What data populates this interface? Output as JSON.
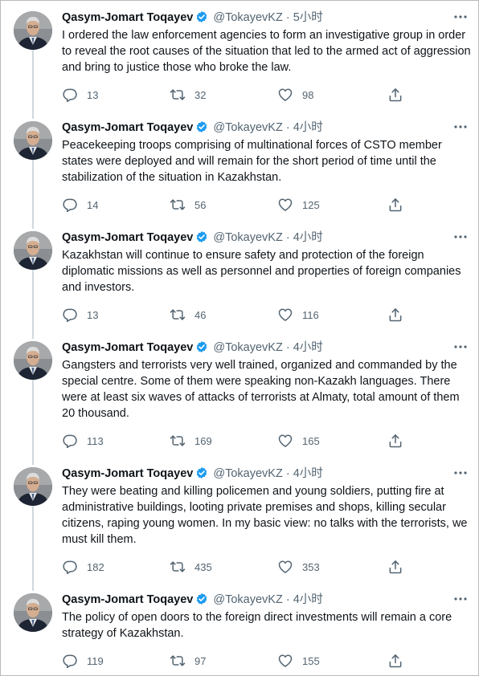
{
  "tweets": [
    {
      "name": "Qasym-Jomart Toqayev",
      "handle": "@TokayevKZ",
      "sep": "·",
      "time": "5小时",
      "text": "I ordered the law enforcement agencies to form an investigative group in order to reveal the root causes of the situation that led to the armed act of aggression and bring to justice those who broke the law.",
      "replies": "13",
      "retweets": "32",
      "likes": "98"
    },
    {
      "name": "Qasym-Jomart Toqayev",
      "handle": "@TokayevKZ",
      "sep": "·",
      "time": "4小时",
      "text": "Peacekeeping troops comprising of multinational forces of CSTO member states were deployed and will remain for the short period of time until the stabilization of the situation in Kazakhstan.",
      "replies": "14",
      "retweets": "56",
      "likes": "125"
    },
    {
      "name": "Qasym-Jomart Toqayev",
      "handle": "@TokayevKZ",
      "sep": "·",
      "time": "4小时",
      "text": "Kazakhstan will continue to ensure safety and protection of the foreign diplomatic missions as well as personnel and properties of foreign companies and investors.",
      "replies": "13",
      "retweets": "46",
      "likes": "116"
    },
    {
      "name": "Qasym-Jomart Toqayev",
      "handle": "@TokayevKZ",
      "sep": "·",
      "time": "4小时",
      "text": "Gangsters and terrorists very well trained, organized and commanded by the special centre. Some of them were speaking non-Kazakh languages. There were at least six waves of attacks of terrorists at Almaty, total amount of them 20 thousand.",
      "replies": "113",
      "retweets": "169",
      "likes": "165"
    },
    {
      "name": "Qasym-Jomart Toqayev",
      "handle": "@TokayevKZ",
      "sep": "·",
      "time": "4小时",
      "text": "They were beating and killing policemen and young soldiers, putting fire at administrative buildings, looting private premises and shops, killing secular citizens, raping young women. In my basic view: no talks with the terrorists, we must kill them.",
      "replies": "182",
      "retweets": "435",
      "likes": "353"
    },
    {
      "name": "Qasym-Jomart Toqayev",
      "handle": "@TokayevKZ",
      "sep": "·",
      "time": "4小时",
      "text": "The policy of open doors to the foreign direct investments will remain a core strategy of Kazakhstan.",
      "replies": "119",
      "retweets": "97",
      "likes": "155"
    }
  ],
  "icons": {
    "verified": "verified-badge-icon",
    "more": "more-options-icon",
    "reply": "reply-icon",
    "retweet": "retweet-icon",
    "like": "like-icon",
    "share": "share-icon"
  },
  "colors": {
    "verified": "#1d9bf0",
    "muted": "#536471",
    "text": "#0f1419",
    "thread": "#cfd9de"
  }
}
